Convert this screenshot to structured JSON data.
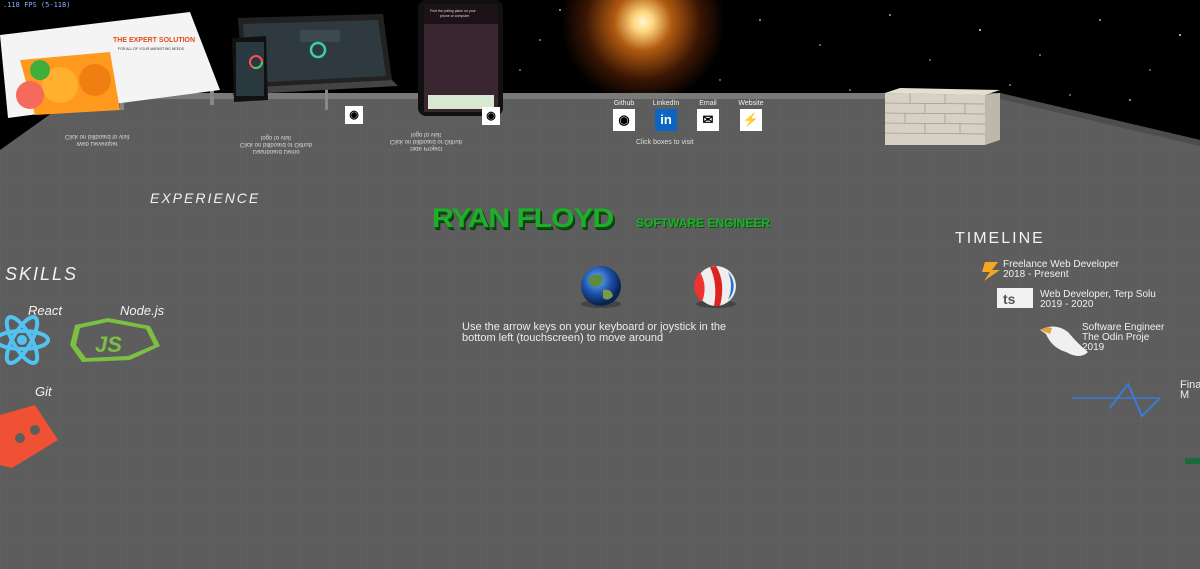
{
  "fps_readout": ".118 FPS (5-118)",
  "hero": {
    "name": "RYAN FLOYD",
    "role": "SOFTWARE ENGINEER",
    "instructions": "Use the arrow keys on your keyboard or joystick in the bottom left (touchscreen) to move around"
  },
  "social": {
    "items": [
      {
        "label": "Github",
        "icon": "github-icon",
        "glyph": "◉"
      },
      {
        "label": "LinkedIn",
        "icon": "linkedin-icon",
        "glyph": "in"
      },
      {
        "label": "Email",
        "icon": "email-icon",
        "glyph": "✉"
      },
      {
        "label": "Website",
        "icon": "website-icon",
        "glyph": "⚡"
      }
    ],
    "hint": "Click boxes to visit"
  },
  "sections": {
    "experience": "EXPERIENCE",
    "skills": "SKILLS",
    "timeline": "TIMELINE"
  },
  "skills": [
    {
      "name": "React",
      "icon": "react-icon"
    },
    {
      "name": "Node.js",
      "icon": "nodejs-icon"
    },
    {
      "name": "Git",
      "icon": "git-icon"
    }
  ],
  "timeline": [
    {
      "text": "Freelance Web Developer\n2018 - Present",
      "icon": "lightning-icon"
    },
    {
      "text": "Web Developer, Terp Solu\n2019 - 2020",
      "icon": "ts-logo-icon"
    },
    {
      "text": "Software Engineer\nThe Odin Proje\n2019",
      "icon": "odin-icon"
    },
    {
      "text": "Finan\nM",
      "icon": "finance-logo-icon"
    }
  ],
  "projects": [
    {
      "text": "Web Developer\nClick on billboard to visit",
      "icon": "github-icon"
    },
    {
      "text": "Dashboard Demo\nClick on billboard or Github\nlogo to visit",
      "icon": "github-icon"
    },
    {
      "text": "Side Project\nClick on billboard or Github\nlogo to visit",
      "icon": "github-icon"
    }
  ],
  "billboards": {
    "one": {
      "headline": "THE EXPERT SOLUTION",
      "sub": "FOR ALL OF YOUR MARKETING NEEDS"
    },
    "three": {
      "line1": "Find the polling place on your",
      "line2": "phone or computer"
    }
  },
  "colors": {
    "accent_green": "#1fae2a",
    "floor": "#5d5d5d",
    "sky": "#000000"
  }
}
